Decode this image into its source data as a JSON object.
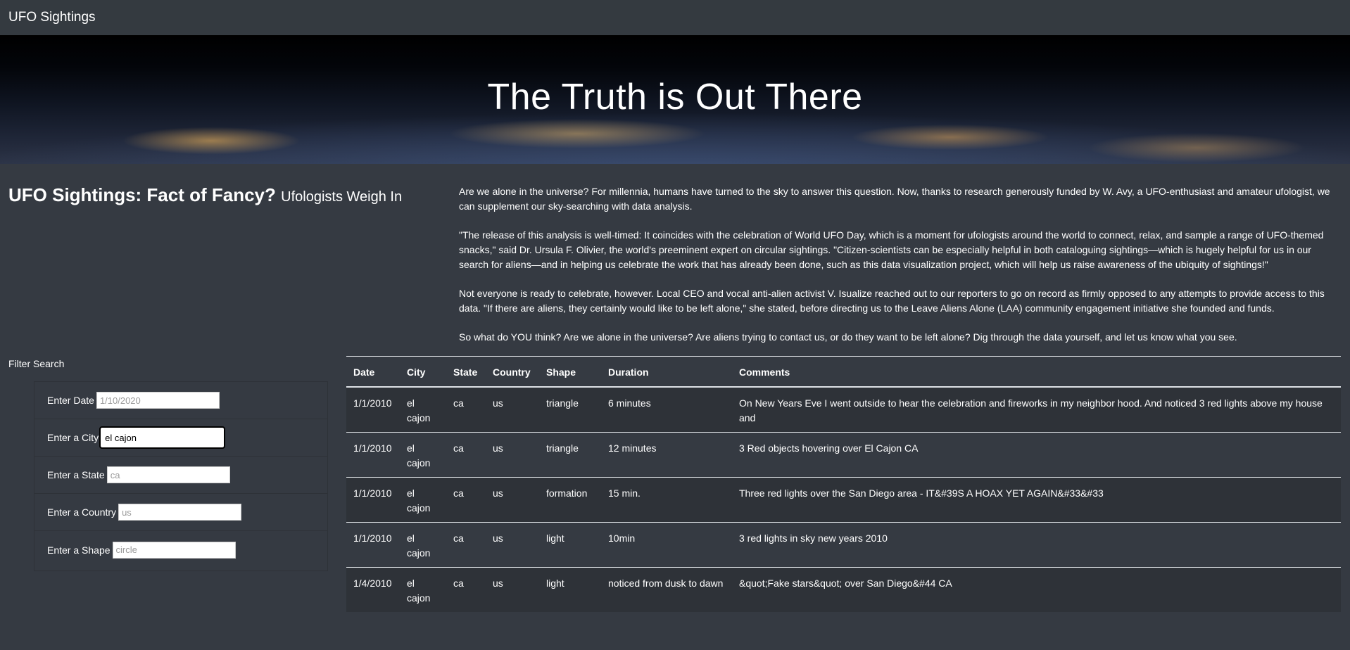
{
  "navbar": {
    "brand": "UFO Sightings"
  },
  "hero": {
    "title": "The Truth is Out There"
  },
  "headline": {
    "main": "UFO Sightings: Fact of Fancy?",
    "sub": "Ufologists Weigh In"
  },
  "article": {
    "paragraphs": [
      "Are we alone in the universe? For millennia, humans have turned to the sky to answer this question. Now, thanks to research generously funded by W. Avy, a UFO-enthusiast and amateur ufologist, we can supplement our sky-searching with data analysis.",
      "\"The release of this analysis is well-timed: It coincides with the celebration of World UFO Day, which is a moment for ufologists around the world to connect, relax, and sample a range of UFO-themed snacks,\" said Dr. Ursula F. Olivier, the world's preeminent expert on circular sightings. \"Citizen-scientists can be especially helpful in both cataloguing sightings—which is hugely helpful for us in our search for aliens—and in helping us celebrate the work that has already been done, such as this data visualization project, which will help us raise awareness of the ubiquity of sightings!\"",
      "Not everyone is ready to celebrate, however. Local CEO and vocal anti-alien activist V. Isualize reached out to our reporters to go on record as firmly opposed to any attempts to provide access to this data. \"If there are aliens, they certainly would like to be left alone,\" she stated, before directing us to the Leave Aliens Alone (LAA) community engagement initiative she founded and funds.",
      "So what do YOU think? Are we alone in the universe? Are aliens trying to contact us, or do they want to be left alone? Dig through the data yourself, and let us know what you see."
    ]
  },
  "filters": {
    "title": "Filter Search",
    "date": {
      "label": "Enter Date",
      "value": "",
      "placeholder": "1/10/2020"
    },
    "city": {
      "label": "Enter a City",
      "value": "el cajon",
      "placeholder": ""
    },
    "state": {
      "label": "Enter a State",
      "value": "",
      "placeholder": "ca"
    },
    "country": {
      "label": "Enter a Country",
      "value": "",
      "placeholder": "us"
    },
    "shape": {
      "label": "Enter a Shape",
      "value": "",
      "placeholder": "circle"
    }
  },
  "table": {
    "headers": [
      "Date",
      "City",
      "State",
      "Country",
      "Shape",
      "Duration",
      "Comments"
    ],
    "rows": [
      [
        "1/1/2010",
        "el cajon",
        "ca",
        "us",
        "triangle",
        "6 minutes",
        "On New Years Eve I went outside to hear the celebration and fireworks in my neighbor hood. And noticed 3 red lights above my house and"
      ],
      [
        "1/1/2010",
        "el cajon",
        "ca",
        "us",
        "triangle",
        "12 minutes",
        "3 Red objects hovering over El Cajon CA"
      ],
      [
        "1/1/2010",
        "el cajon",
        "ca",
        "us",
        "formation",
        "15 min.",
        "Three red lights over the San Diego area - IT&#39S A HOAX YET AGAIN&#33&#33"
      ],
      [
        "1/1/2010",
        "el cajon",
        "ca",
        "us",
        "light",
        "10min",
        "3 red lights in sky new years 2010"
      ],
      [
        "1/4/2010",
        "el cajon",
        "ca",
        "us",
        "light",
        "noticed from dusk to dawn",
        "&quot;Fake stars&quot; over San Diego&#44 CA"
      ]
    ]
  }
}
